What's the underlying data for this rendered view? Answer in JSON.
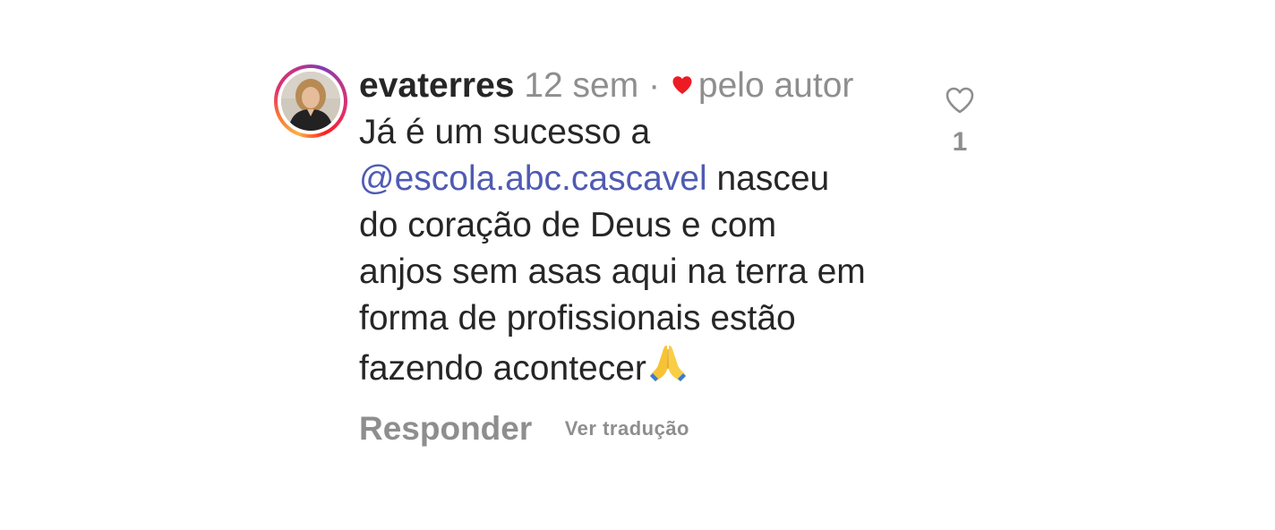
{
  "comment": {
    "username": "evaterres",
    "time": "12 sem",
    "separator": "·",
    "liked_by": "pelo autor",
    "text_line1": "Já é um sucesso a",
    "mention": "@escola.abc.cascavel",
    "text_after_mention": " nasceu",
    "text_line3": "do coração de Deus e com",
    "text_line4": "anjos sem asas aqui na terra em",
    "text_line5": "forma de profissionais estão",
    "text_line6": "fazendo acontecer",
    "like_count": "1",
    "reply_label": "Responder",
    "translate_label": "Ver tradução"
  },
  "colors": {
    "mention": "#4f5bb3",
    "author_heart": "#ed1b24",
    "muted": "#8e8e8e",
    "text": "#262626"
  },
  "icons": {
    "author_like": "red-heart-icon",
    "emoji": "folded-hands-emoji-icon",
    "like": "heart-outline-icon",
    "avatar": "user-avatar"
  }
}
